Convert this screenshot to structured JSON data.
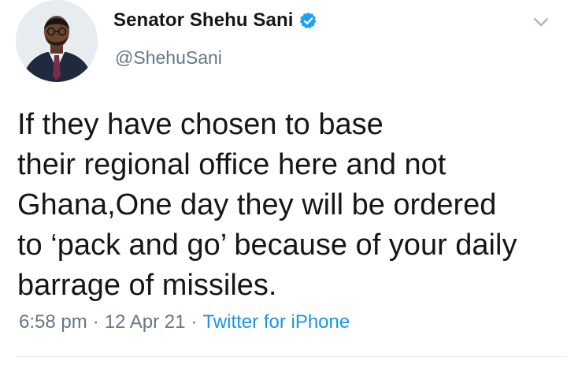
{
  "author": {
    "display_name": "Senator Shehu Sani",
    "handle": "@ShehuSani",
    "verified_icon": "verified-badge-icon",
    "avatar_icon": "profile-photo"
  },
  "menu": {
    "icon": "chevron-down-icon"
  },
  "tweet": {
    "lines": [
      "If they have chosen to base",
      "their regional office here and not",
      "Ghana,One day they will be ordered",
      "to ‘pack and go’ because of your daily",
      "barrage of missiles."
    ]
  },
  "meta": {
    "time": "6:58 pm",
    "separator": "·",
    "date": "12 Apr 21",
    "source": "Twitter for iPhone"
  },
  "colors": {
    "text": "#14171a",
    "secondary": "#657786",
    "link": "#1b95e0",
    "verified": "#1da1f2"
  }
}
